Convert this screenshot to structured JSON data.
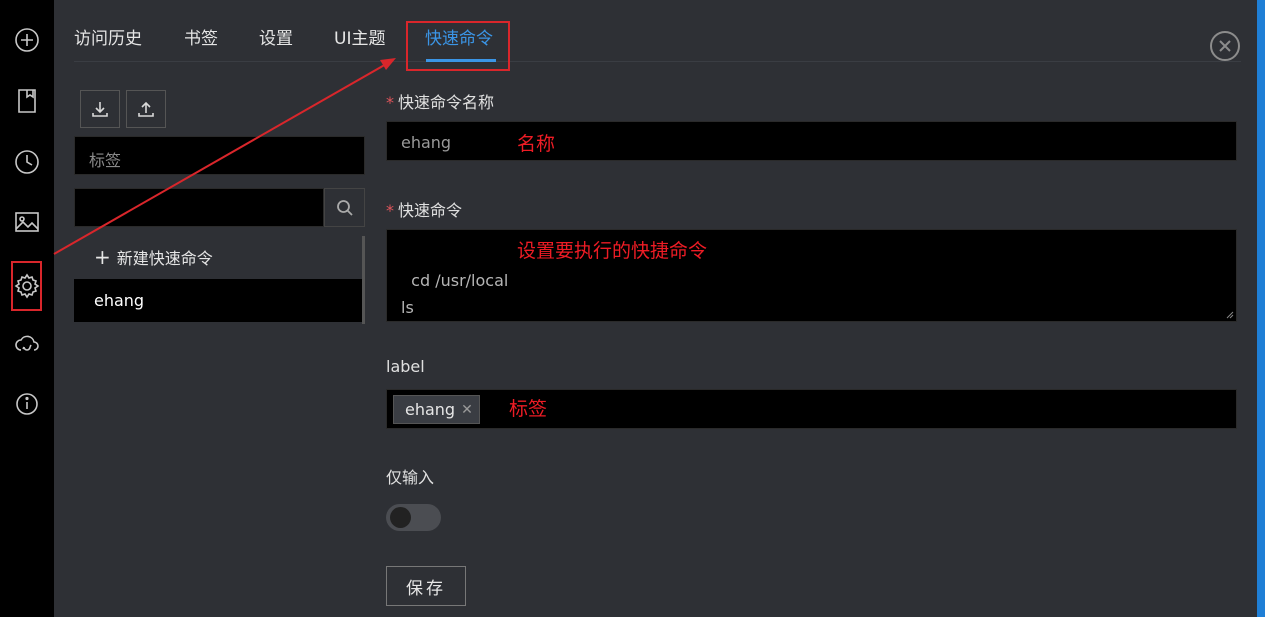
{
  "sidebar": {
    "icons": [
      "add-circle-icon",
      "bookmark-icon",
      "clock-icon",
      "image-icon",
      "gear-icon",
      "cloud-sync-icon",
      "info-icon"
    ]
  },
  "tabs": [
    {
      "label": "访问历史"
    },
    {
      "label": "书签"
    },
    {
      "label": "设置"
    },
    {
      "label": "UI主题"
    },
    {
      "label": "快速命令",
      "active": true
    }
  ],
  "list_panel": {
    "tag_filter_placeholder": "标签",
    "search_value": "",
    "add_label": "新建快速命令",
    "items": [
      "ehang"
    ]
  },
  "form": {
    "name_label": "快速命令名称",
    "name_value": "ehang",
    "command_label": "快速命令",
    "command_value": "cd /usr/local\nls",
    "tag_label": "label",
    "tags": [
      "ehang"
    ],
    "input_only_label": "仅输入",
    "input_only": false,
    "save_label": "保存"
  },
  "annotations": {
    "name_note": "名称",
    "command_note": "设置要执行的快捷命令",
    "tag_note": "标签"
  },
  "colors": {
    "accent": "#3b95e6",
    "annotation": "#ee1c25",
    "required": "#e0555b"
  }
}
